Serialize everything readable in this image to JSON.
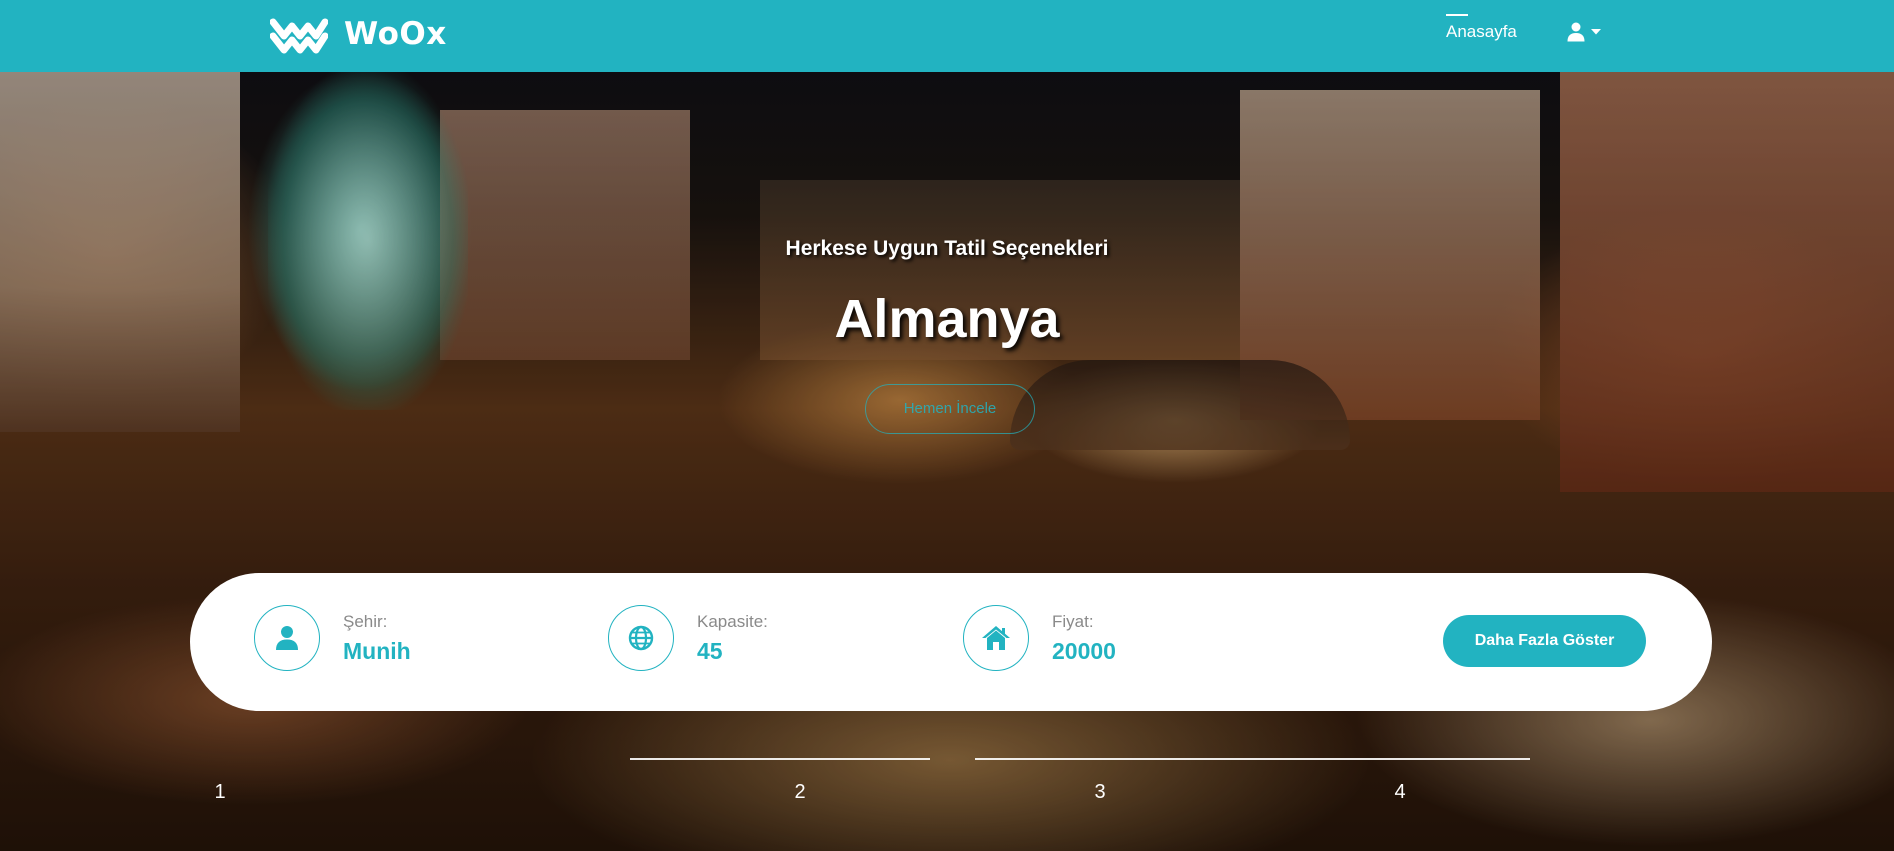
{
  "app": {
    "brand": "WoOx"
  },
  "nav": {
    "home_label": "Anasayfa",
    "user_icon": "user-icon",
    "caret_icon": "caret-down-icon"
  },
  "hero": {
    "subtitle": "Herkese Uygun Tatil Seçenekleri",
    "title": "Almanya",
    "cta_label": "Hemen İncele"
  },
  "info": {
    "city_label": "Şehir:",
    "city_value": "Munih",
    "capacity_label": "Kapasite:",
    "capacity_value": "45",
    "price_label": "Fiyat:",
    "price_value": "20000",
    "more_button": "Daha Fazla Göster"
  },
  "pagination": {
    "pages": [
      "1",
      "2",
      "3",
      "4"
    ],
    "active": "1"
  },
  "colors": {
    "accent": "#22b3c1",
    "card_bg": "#ffffff",
    "label_gray": "#8a8a8a"
  }
}
